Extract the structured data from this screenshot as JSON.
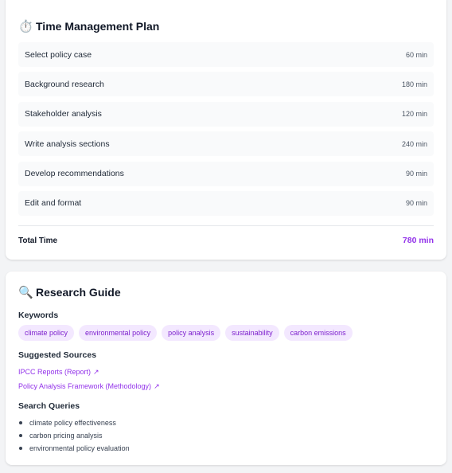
{
  "time_plan": {
    "icon": "stopwatch-icon",
    "icon_glyph": "⏱️",
    "title": "Time Management Plan",
    "tasks": [
      {
        "name": "Select policy case",
        "minutes": "60 min"
      },
      {
        "name": "Background research",
        "minutes": "180 min"
      },
      {
        "name": "Stakeholder analysis",
        "minutes": "120 min"
      },
      {
        "name": "Write analysis sections",
        "minutes": "240 min"
      },
      {
        "name": "Develop recommendations",
        "minutes": "90 min"
      },
      {
        "name": "Edit and format",
        "minutes": "90 min"
      }
    ],
    "total_label": "Total Time",
    "total_value": "780 min"
  },
  "research_guide": {
    "icon": "magnifier-icon",
    "icon_glyph": "🔍",
    "title": "Research Guide",
    "keywords_label": "Keywords",
    "keywords": [
      "climate policy",
      "environmental policy",
      "policy analysis",
      "sustainability",
      "carbon emissions"
    ],
    "sources_label": "Suggested Sources",
    "sources": [
      {
        "label": "IPCC Reports (Report)",
        "icon": "external-link-icon"
      },
      {
        "label": "Policy Analysis Framework (Methodology)",
        "icon": "external-link-icon"
      }
    ],
    "external_link_glyph": "↗",
    "queries_label": "Search Queries",
    "queries": [
      "climate policy effectiveness",
      "carbon pricing analysis",
      "environmental policy evaluation"
    ]
  },
  "colors": {
    "accent": "#9333ea",
    "chip_bg": "#f3e8ff",
    "row_bg": "#f9fafb"
  }
}
